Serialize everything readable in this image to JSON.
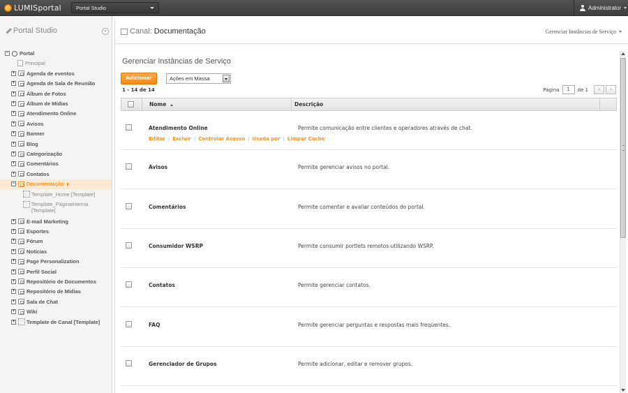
{
  "topbar": {
    "logo_text": "LUMISportal",
    "site_select": "Portal Studio",
    "user": "Administrator"
  },
  "sidebar": {
    "title": "Portal Studio",
    "collapse_label": "«",
    "tree": [
      {
        "label": "Portal",
        "type": "root"
      },
      {
        "label": "Principal",
        "type": "page"
      },
      {
        "label": "Agenda de eventos",
        "type": "channel"
      },
      {
        "label": "Agenda de Sala de Reunião",
        "type": "channel"
      },
      {
        "label": "Álbum de Fotos",
        "type": "channel"
      },
      {
        "label": "Álbum de Mídias",
        "type": "channel"
      },
      {
        "label": "Atendimento Online",
        "type": "channel"
      },
      {
        "label": "Avisos",
        "type": "channel"
      },
      {
        "label": "Banner",
        "type": "channel"
      },
      {
        "label": "Blog",
        "type": "channel"
      },
      {
        "label": "Categorização",
        "type": "channel"
      },
      {
        "label": "Comentários",
        "type": "channel"
      },
      {
        "label": "Contatos",
        "type": "channel"
      },
      {
        "label": "Documentação",
        "type": "channel-active"
      },
      {
        "label": "Template_Home [Template]",
        "type": "template"
      },
      {
        "label": "Template_PáginaInterna",
        "label2": "[Template]",
        "type": "template"
      },
      {
        "label": "E-mail Marketing",
        "type": "channel"
      },
      {
        "label": "Esportes",
        "type": "channel"
      },
      {
        "label": "Fórum",
        "type": "channel"
      },
      {
        "label": "Notícias",
        "type": "channel"
      },
      {
        "label": "Page Personalization",
        "type": "channel"
      },
      {
        "label": "Perfil Social",
        "type": "channel"
      },
      {
        "label": "Repositório de Documentos",
        "type": "channel"
      },
      {
        "label": "Repositório de Mídias",
        "type": "channel"
      },
      {
        "label": "Sala de Chat",
        "type": "channel"
      },
      {
        "label": "Wiki",
        "type": "channel"
      },
      {
        "label": "Template de Canal [Template]",
        "type": "channel-template"
      }
    ]
  },
  "main": {
    "canal_prefix": "Canal:",
    "canal_name": "Documentação",
    "gerenciar_link": "Gerenciar Instâncias de Serviço",
    "section_title": "Gerenciar Instâncias de Serviço",
    "add_button": "Adicionar",
    "mass_actions": "Ações em Massa",
    "count": "1 - 14 de 14",
    "pager": {
      "label": "Página",
      "current": "1",
      "of": "de 1",
      "prev": "‹",
      "next": "›"
    },
    "columns": {
      "nome": "Nome",
      "descricao": "Descrição"
    },
    "row_actions": [
      "Editar",
      "Excluir",
      "Controlar Acesso",
      "Usada por",
      "Limpar Cache"
    ],
    "rows": [
      {
        "name": "Atendimento Online",
        "desc": "Permite comunicação entre clientes e operadores através de chat."
      },
      {
        "name": "Avisos",
        "desc": "Permite gerenciar avisos no portal."
      },
      {
        "name": "Comentários",
        "desc": "Permite comentar e avaliar conteúdos do portal."
      },
      {
        "name": "Consumidor WSRP",
        "desc": "Permite consumir portlets remotos utilizando WSRP."
      },
      {
        "name": "Contatos",
        "desc": "Permite gerenciar contatos."
      },
      {
        "name": "FAQ",
        "desc": "Permite gerenciar perguntas e respostas mais freqüentes."
      },
      {
        "name": "Gerenciador de Grupos",
        "desc": "Permite adicionar, editar e remover grupos."
      }
    ]
  },
  "colors": {
    "accent": "#f7941d",
    "topbar": "#474747",
    "sidebar_bg": "#f4f4f4"
  }
}
